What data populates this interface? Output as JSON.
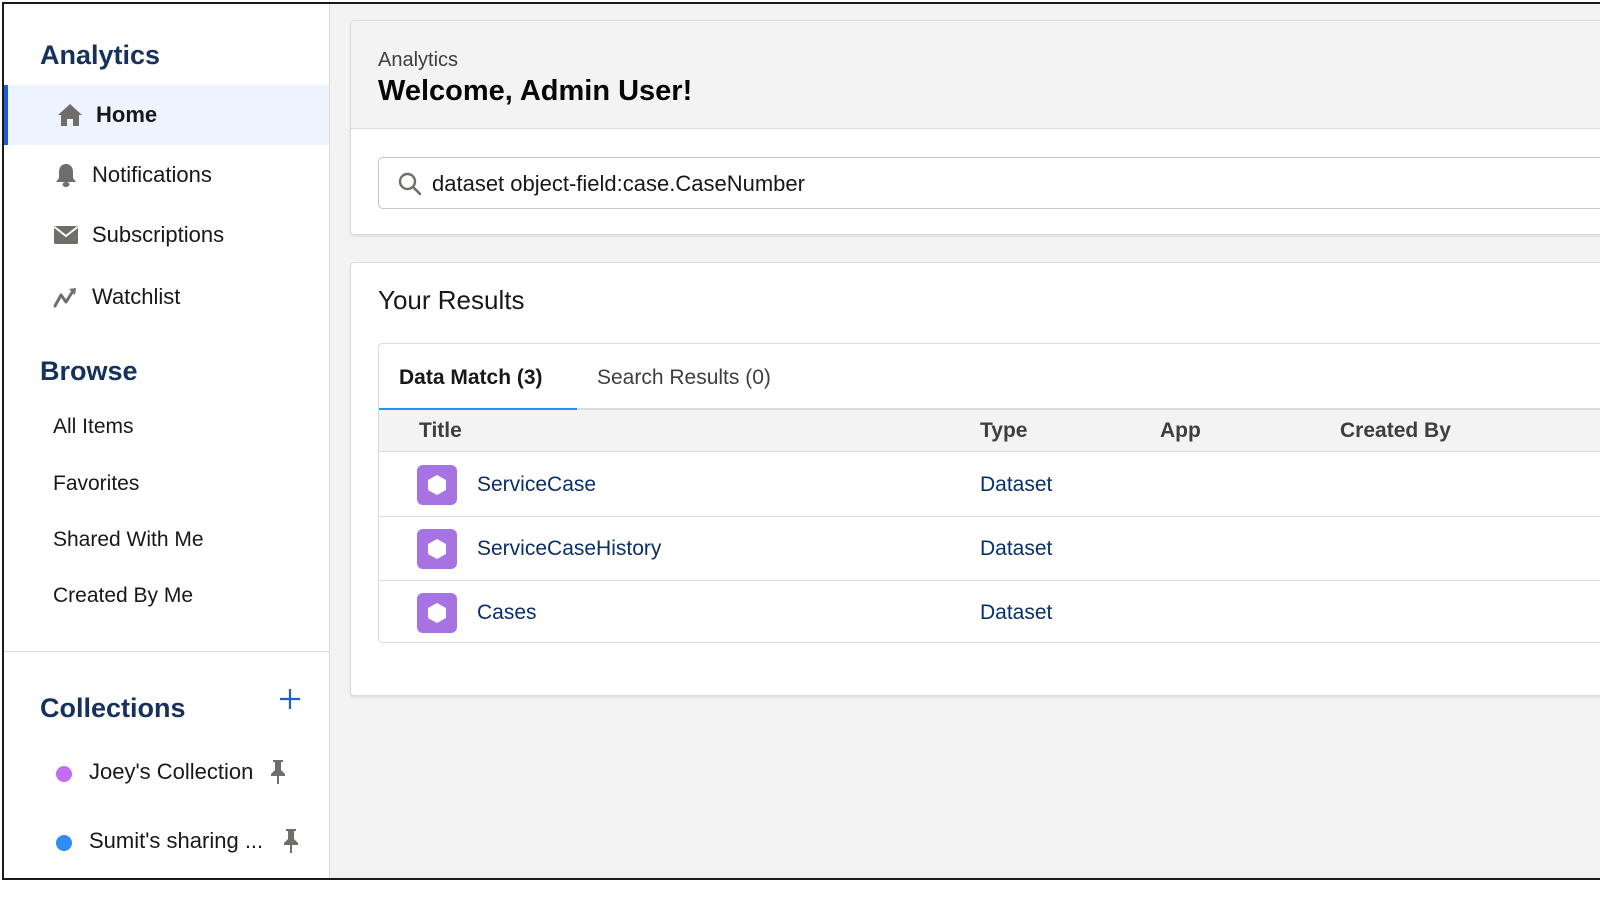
{
  "sidebar": {
    "title": "Analytics",
    "nav": [
      {
        "label": "Home",
        "icon": "home-icon"
      },
      {
        "label": "Notifications",
        "icon": "bell-icon"
      },
      {
        "label": "Subscriptions",
        "icon": "envelope-icon"
      },
      {
        "label": "Watchlist",
        "icon": "trend-icon"
      }
    ],
    "browse_title": "Browse",
    "browse": [
      "All Items",
      "Favorites",
      "Shared With Me",
      "Created By Me"
    ],
    "collections_title": "Collections",
    "collections": [
      {
        "label": "Joey's Collection",
        "color": "#c36ef2"
      },
      {
        "label": "Sumit's sharing ...",
        "color": "#2f8cf0"
      }
    ]
  },
  "header": {
    "eyebrow": "Analytics",
    "welcome": "Welcome, Admin User!",
    "search_value": "dataset object-field:case.CaseNumber"
  },
  "results": {
    "title": "Your Results",
    "tabs": [
      {
        "label": "Data Match (3)",
        "active": true
      },
      {
        "label": "Search Results (0)",
        "active": false
      }
    ],
    "columns": [
      "Title",
      "Type",
      "App",
      "Created By"
    ],
    "rows": [
      {
        "title": "ServiceCase",
        "type": "Dataset",
        "app": "",
        "created_by": ""
      },
      {
        "title": "ServiceCaseHistory",
        "type": "Dataset",
        "app": "",
        "created_by": ""
      },
      {
        "title": "Cases",
        "type": "Dataset",
        "app": "",
        "created_by": ""
      }
    ]
  },
  "colors": {
    "accent": "#1b5fd1",
    "tab_underline": "#1b96ff",
    "dataset_icon": "#a773e3",
    "link": "#0b2e6b"
  }
}
